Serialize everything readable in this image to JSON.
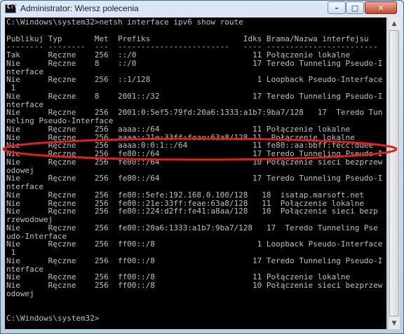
{
  "window": {
    "title": "Administrator: Wiersz polecenia",
    "controls": {
      "minimize": "–",
      "maximize": "□",
      "close": "✕"
    }
  },
  "console": {
    "lines": [
      "C:\\Windows\\system32>netsh interface ipv6 show route",
      "",
      "Publikuj Typ       Met  Prefiks                    Idks Brama/Nazwa interfejsu",
      "-------- --------  ---  ------------------------   ---- ------------------------",
      "Tak      Ręczne    256  ::/0                         11 Połączenie lokalne",
      "Nie      Ręczne    8    ::/0                         17 Teredo Tunneling Pseudo-I",
      "nterface",
      "Nie      Ręczne    256  ::1/128                       1 Loopback Pseudo-Interface",
      " 1",
      "Nie      Ręczne    8    2001::/32                    17 Teredo Tunneling Pseudo-I",
      "nterface",
      "Nie      Ręczne    256  2001:0:5ef5:79fd:20a6:1333:a1b7:9ba7/128   17  Teredo Tun",
      "neling Pseudo-Interface",
      "Nie      Ręczne    256  aaaa::/64                    11 Połączenie lokalne",
      "Nie      Ręczne    256  aaaa::21e:33ff:feae:63a8/128 11  Połączenie lokalne",
      "Nie      Ręczne    256  aaaa:0:0:1::/64              11 fe80::aa:bbff:fecc:ddee",
      "Nie      Ręczne    256  fe80::/64                    17 Teredo Tunneling Pseudo-I",
      "Nie      Ręczne    256  fe80::/64                    10 Połączenie sieci bezprzew",
      "odowej",
      "Nie      Ręczne    256  fe80::/64                    17 Teredo Tunneling Pseudo-I",
      "nterface",
      "Nie      Ręczne    256  fe80::5efe:192.168.0.100/128   18  isatap.marsoft.net",
      "Nie      Ręczne    256  fe80::21e:33ff:feae:63a8/128   11  Połączenie lokalne",
      "Nie      Ręczne    256  fe80::224:d2ff:fe41:a8aa/128   10  Połączenie sieci bezp",
      "rzewodowej",
      "Nie      Ręczne    256  fe80::20a6:1333:a1b7:9ba7/128   17  Teredo Tunneling Pse",
      "udo-Interface",
      "Nie      Ręczne    256  ff00::/8                      1 Loopback Pseudo-Interface",
      " 1",
      "Nie      Ręczne    256  ff00::/8                     17 Teredo Tunneling Pseudo-I",
      "nterface",
      "Nie      Ręczne    256  ff00::/8                     11 Połączenie lokalne",
      "Nie      Ręczne    256  ff00::/8                     10 Połączenie sieci bezprzew",
      "odowej",
      "",
      "",
      "C:\\Windows\\system32>"
    ]
  },
  "annotation": {
    "color": "#e0201c"
  },
  "colors": {
    "console_bg": "#000000",
    "console_fg": "#c0c0c0"
  },
  "icons": {
    "window_icon": "cmd-icon"
  }
}
